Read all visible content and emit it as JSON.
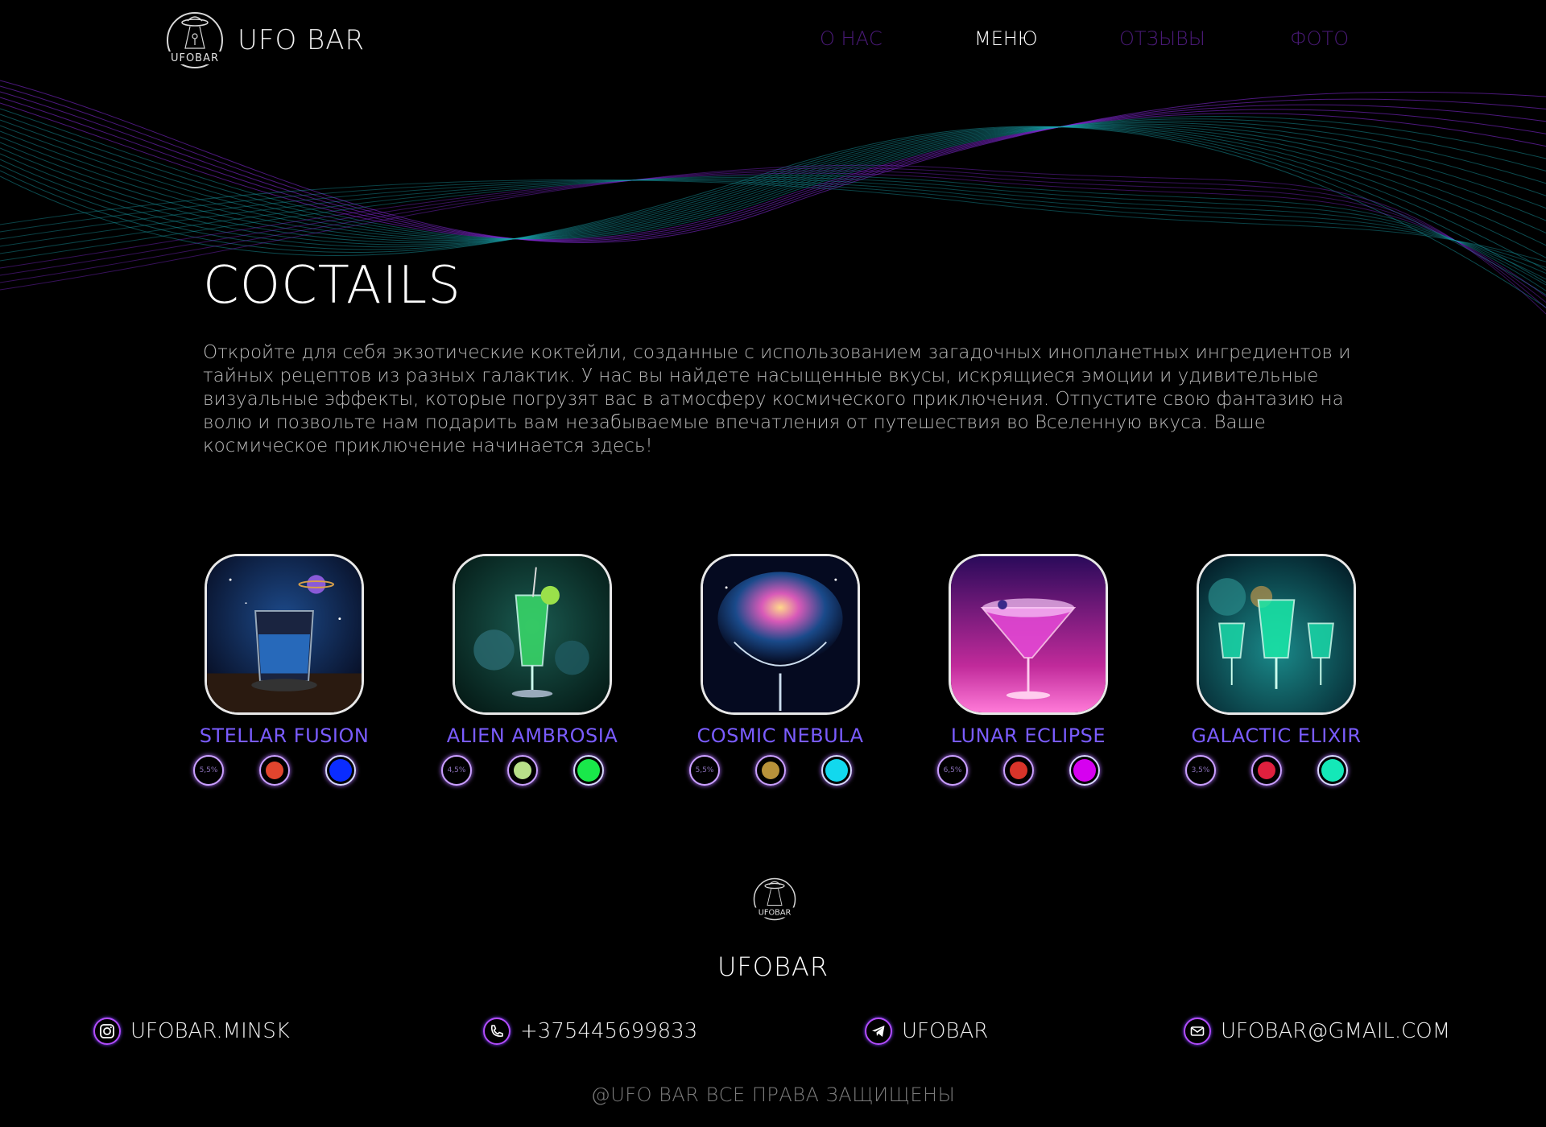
{
  "header": {
    "brand": "UFO BAR",
    "logo_text": "UFOBAR",
    "nav": [
      {
        "label": "О НАС"
      },
      {
        "label": "МЕНЮ"
      },
      {
        "label": "ОТЗЫВЫ"
      },
      {
        "label": "ФОТО"
      }
    ]
  },
  "hero": {
    "title": "COCTAILS",
    "text": "Откройте для себя экзотические коктейли, созданные с использованием загадочных инопланетных ингредиентов и тайных рецептов из разных галактик. У нас вы найдете насыщенные вкусы, искрящиеся эмоции и удивительные визуальные эффекты, которые погрузят вас в атмосферу космического приключения. Отпустите свою фантазию на волю и позвольте нам подарить вам незабываемые впечатления от путешествия во Вселенную вкуса. Ваше космическое приключение начинается здесь!"
  },
  "cocktails": [
    {
      "name": "STELLAR FUSION",
      "abv": "5,5%",
      "ingredient_color": "#e2452e",
      "color": "#0a2cff"
    },
    {
      "name": "ALIEN AMBROSIA",
      "abv": "4,5%",
      "ingredient_color": "#b8e08a",
      "color": "#19e84a"
    },
    {
      "name": "COSMIC NEBULA",
      "abv": "5,5%",
      "ingredient_color": "#b8923a",
      "color": "#12d8ee"
    },
    {
      "name": "LUNAR ECLIPSE",
      "abv": "6,5%",
      "ingredient_color": "#d8342a",
      "color": "#d600f0"
    },
    {
      "name": "GALACTIC ELIXIR",
      "abv": "3,5%",
      "ingredient_color": "#e0203e",
      "color": "#14e8b8"
    }
  ],
  "footer": {
    "logo_text": "UFOBAR",
    "title": "UFOBAR",
    "contacts": {
      "instagram": "UFOBAR.MINSK",
      "phone": "+375445699833",
      "telegram": "UFOBAR",
      "email": "UFOBAR@GMAIL.COM"
    },
    "copyright": "@UFO BAR ВСЕ ПРАВА ЗАЩИЩЕНЫ"
  },
  "colors": {
    "accent": "#7a5cff",
    "nav_inactive": "#4a1a78",
    "wave_teal": "#1aa6b0",
    "wave_purple": "#8a2be2"
  }
}
